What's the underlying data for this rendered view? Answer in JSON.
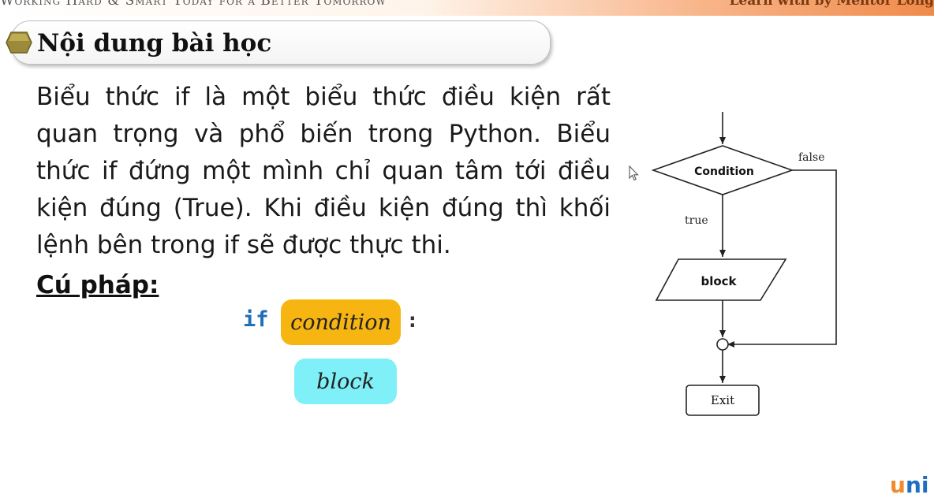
{
  "banner": {
    "slogan": "Working Hard & Smart Today for a Better Tomorrow",
    "right_text": "Learn with by Mentor Long"
  },
  "header": {
    "title": "Nội dung bài học",
    "bullet_icon": "hexagon-bullet-icon"
  },
  "content": {
    "paragraph": "Biểu thức if là một biểu thức điều kiện rất quan trọng và phổ biến trong Python. Biểu thức if đứng một mình chỉ quan tâm tới điều kiện đúng (True). Khi điều kiện đúng thì khối lệnh bên trong if sẽ được thực thi.",
    "syntax_label": "Cú pháp:"
  },
  "syntax": {
    "keyword": "if",
    "condition": "condition",
    "colon": ":",
    "block": "block",
    "colors": {
      "keyword": "#1d6fb8",
      "condition_bg": "#f7b511",
      "block_bg": "#7ff0f8"
    }
  },
  "flowchart": {
    "condition": "Condition",
    "false_label": "false",
    "true_label": "true",
    "block": "block",
    "exit": "Exit"
  },
  "logo": {
    "u": "u",
    "n": "n",
    "i": "i"
  }
}
